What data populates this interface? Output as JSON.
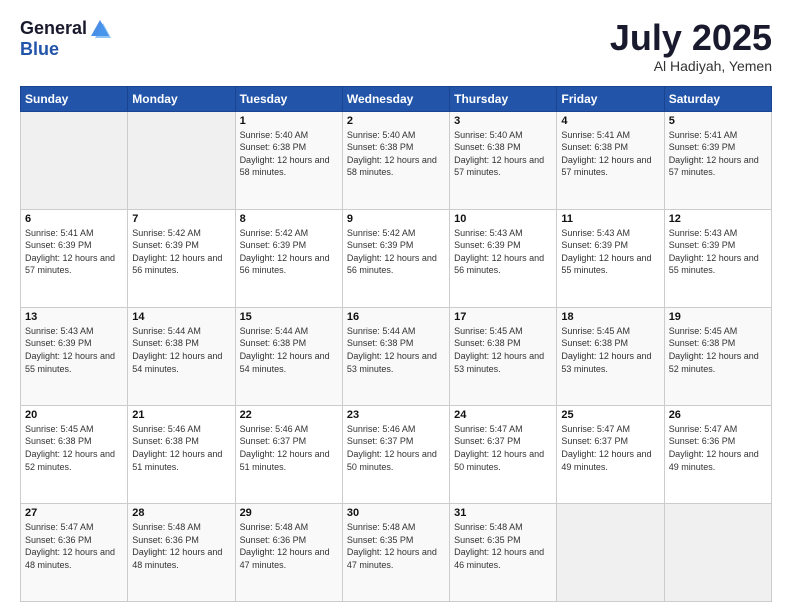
{
  "header": {
    "logo_general": "General",
    "logo_blue": "Blue",
    "month_title": "July 2025",
    "subtitle": "Al Hadiyah, Yemen"
  },
  "days_of_week": [
    "Sunday",
    "Monday",
    "Tuesday",
    "Wednesday",
    "Thursday",
    "Friday",
    "Saturday"
  ],
  "weeks": [
    [
      {
        "day": "",
        "sunrise": "",
        "sunset": "",
        "daylight": "",
        "empty": true
      },
      {
        "day": "",
        "sunrise": "",
        "sunset": "",
        "daylight": "",
        "empty": true
      },
      {
        "day": "1",
        "sunrise": "Sunrise: 5:40 AM",
        "sunset": "Sunset: 6:38 PM",
        "daylight": "Daylight: 12 hours and 58 minutes."
      },
      {
        "day": "2",
        "sunrise": "Sunrise: 5:40 AM",
        "sunset": "Sunset: 6:38 PM",
        "daylight": "Daylight: 12 hours and 58 minutes."
      },
      {
        "day": "3",
        "sunrise": "Sunrise: 5:40 AM",
        "sunset": "Sunset: 6:38 PM",
        "daylight": "Daylight: 12 hours and 57 minutes."
      },
      {
        "day": "4",
        "sunrise": "Sunrise: 5:41 AM",
        "sunset": "Sunset: 6:38 PM",
        "daylight": "Daylight: 12 hours and 57 minutes."
      },
      {
        "day": "5",
        "sunrise": "Sunrise: 5:41 AM",
        "sunset": "Sunset: 6:39 PM",
        "daylight": "Daylight: 12 hours and 57 minutes."
      }
    ],
    [
      {
        "day": "6",
        "sunrise": "Sunrise: 5:41 AM",
        "sunset": "Sunset: 6:39 PM",
        "daylight": "Daylight: 12 hours and 57 minutes."
      },
      {
        "day": "7",
        "sunrise": "Sunrise: 5:42 AM",
        "sunset": "Sunset: 6:39 PM",
        "daylight": "Daylight: 12 hours and 56 minutes."
      },
      {
        "day": "8",
        "sunrise": "Sunrise: 5:42 AM",
        "sunset": "Sunset: 6:39 PM",
        "daylight": "Daylight: 12 hours and 56 minutes."
      },
      {
        "day": "9",
        "sunrise": "Sunrise: 5:42 AM",
        "sunset": "Sunset: 6:39 PM",
        "daylight": "Daylight: 12 hours and 56 minutes."
      },
      {
        "day": "10",
        "sunrise": "Sunrise: 5:43 AM",
        "sunset": "Sunset: 6:39 PM",
        "daylight": "Daylight: 12 hours and 56 minutes."
      },
      {
        "day": "11",
        "sunrise": "Sunrise: 5:43 AM",
        "sunset": "Sunset: 6:39 PM",
        "daylight": "Daylight: 12 hours and 55 minutes."
      },
      {
        "day": "12",
        "sunrise": "Sunrise: 5:43 AM",
        "sunset": "Sunset: 6:39 PM",
        "daylight": "Daylight: 12 hours and 55 minutes."
      }
    ],
    [
      {
        "day": "13",
        "sunrise": "Sunrise: 5:43 AM",
        "sunset": "Sunset: 6:39 PM",
        "daylight": "Daylight: 12 hours and 55 minutes."
      },
      {
        "day": "14",
        "sunrise": "Sunrise: 5:44 AM",
        "sunset": "Sunset: 6:38 PM",
        "daylight": "Daylight: 12 hours and 54 minutes."
      },
      {
        "day": "15",
        "sunrise": "Sunrise: 5:44 AM",
        "sunset": "Sunset: 6:38 PM",
        "daylight": "Daylight: 12 hours and 54 minutes."
      },
      {
        "day": "16",
        "sunrise": "Sunrise: 5:44 AM",
        "sunset": "Sunset: 6:38 PM",
        "daylight": "Daylight: 12 hours and 53 minutes."
      },
      {
        "day": "17",
        "sunrise": "Sunrise: 5:45 AM",
        "sunset": "Sunset: 6:38 PM",
        "daylight": "Daylight: 12 hours and 53 minutes."
      },
      {
        "day": "18",
        "sunrise": "Sunrise: 5:45 AM",
        "sunset": "Sunset: 6:38 PM",
        "daylight": "Daylight: 12 hours and 53 minutes."
      },
      {
        "day": "19",
        "sunrise": "Sunrise: 5:45 AM",
        "sunset": "Sunset: 6:38 PM",
        "daylight": "Daylight: 12 hours and 52 minutes."
      }
    ],
    [
      {
        "day": "20",
        "sunrise": "Sunrise: 5:45 AM",
        "sunset": "Sunset: 6:38 PM",
        "daylight": "Daylight: 12 hours and 52 minutes."
      },
      {
        "day": "21",
        "sunrise": "Sunrise: 5:46 AM",
        "sunset": "Sunset: 6:38 PM",
        "daylight": "Daylight: 12 hours and 51 minutes."
      },
      {
        "day": "22",
        "sunrise": "Sunrise: 5:46 AM",
        "sunset": "Sunset: 6:37 PM",
        "daylight": "Daylight: 12 hours and 51 minutes."
      },
      {
        "day": "23",
        "sunrise": "Sunrise: 5:46 AM",
        "sunset": "Sunset: 6:37 PM",
        "daylight": "Daylight: 12 hours and 50 minutes."
      },
      {
        "day": "24",
        "sunrise": "Sunrise: 5:47 AM",
        "sunset": "Sunset: 6:37 PM",
        "daylight": "Daylight: 12 hours and 50 minutes."
      },
      {
        "day": "25",
        "sunrise": "Sunrise: 5:47 AM",
        "sunset": "Sunset: 6:37 PM",
        "daylight": "Daylight: 12 hours and 49 minutes."
      },
      {
        "day": "26",
        "sunrise": "Sunrise: 5:47 AM",
        "sunset": "Sunset: 6:36 PM",
        "daylight": "Daylight: 12 hours and 49 minutes."
      }
    ],
    [
      {
        "day": "27",
        "sunrise": "Sunrise: 5:47 AM",
        "sunset": "Sunset: 6:36 PM",
        "daylight": "Daylight: 12 hours and 48 minutes."
      },
      {
        "day": "28",
        "sunrise": "Sunrise: 5:48 AM",
        "sunset": "Sunset: 6:36 PM",
        "daylight": "Daylight: 12 hours and 48 minutes."
      },
      {
        "day": "29",
        "sunrise": "Sunrise: 5:48 AM",
        "sunset": "Sunset: 6:36 PM",
        "daylight": "Daylight: 12 hours and 47 minutes."
      },
      {
        "day": "30",
        "sunrise": "Sunrise: 5:48 AM",
        "sunset": "Sunset: 6:35 PM",
        "daylight": "Daylight: 12 hours and 47 minutes."
      },
      {
        "day": "31",
        "sunrise": "Sunrise: 5:48 AM",
        "sunset": "Sunset: 6:35 PM",
        "daylight": "Daylight: 12 hours and 46 minutes."
      },
      {
        "day": "",
        "sunrise": "",
        "sunset": "",
        "daylight": "",
        "empty": true
      },
      {
        "day": "",
        "sunrise": "",
        "sunset": "",
        "daylight": "",
        "empty": true
      }
    ]
  ]
}
